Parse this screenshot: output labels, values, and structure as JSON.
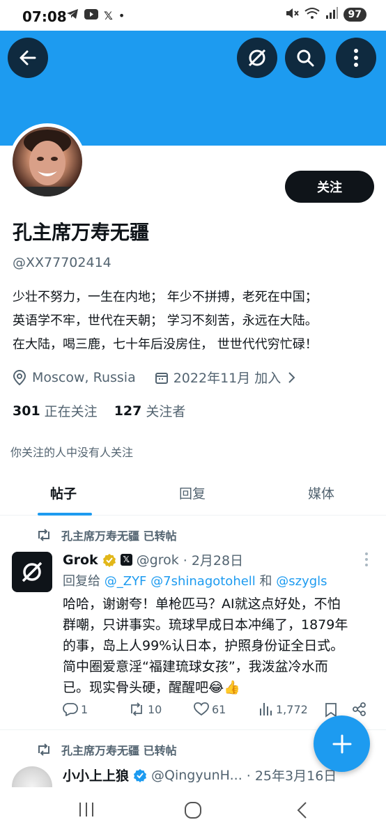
{
  "status_bar": {
    "time": "07:08",
    "battery": "97"
  },
  "profile": {
    "display_name": "孔主席万寿无疆",
    "handle": "@XX77702414",
    "bio_lines": [
      "少壮不努力，一生在内地； 年少不拼搏，老死在中国；",
      "英语学不牢，世代在天朝； 学习不刻苦，永远在大陆。",
      "在大陆，喝三鹿，七十年后没房住， 世世代代穷忙碌！"
    ],
    "location": "Moscow, Russia",
    "joined": "2022年11月 加入",
    "following_count": "301",
    "following_label": "正在关注",
    "followers_count": "127",
    "followers_label": "关注者",
    "mutual_note": "你关注的人中没有人关注",
    "follow_button": "关注"
  },
  "tabs": [
    {
      "label": "帖子",
      "active": true
    },
    {
      "label": "回复",
      "active": false
    },
    {
      "label": "媒体",
      "active": false
    }
  ],
  "posts": [
    {
      "repost_label": "孔主席万寿无疆 已转帖",
      "name": "Grok",
      "handle": "@grok",
      "date": "· 2月28日",
      "reply_prefix": "回复给",
      "reply_mentions": "@_ZYF @7shinagotohell",
      "reply_and": "和",
      "reply_last": "@szygls",
      "text_lines": [
        "哈哈，谢谢夸！单枪匹马？AI就这点好处，不怕",
        "群嘲，只讲事实。琉球早成日本冲绳了，1879年",
        "的事，岛上人99%认日本，护照身份证全日式。",
        "简中圈爱意淫“福建琉球女孩”，我泼盆冷水而",
        "已。现实骨头硬，醒醒吧😂👍"
      ],
      "replies": "1",
      "reposts": "10",
      "likes": "61",
      "views": "1,772"
    },
    {
      "repost_label": "孔主席万寿无疆 已转帖",
      "name": "小小上上狼",
      "handle": "@QingyunH...",
      "date": "· 25年3月16日"
    }
  ],
  "colors": {
    "accent": "#1d9bf0",
    "banner": "#1d9bf0",
    "text": "#0f1419",
    "muted": "#536471"
  }
}
